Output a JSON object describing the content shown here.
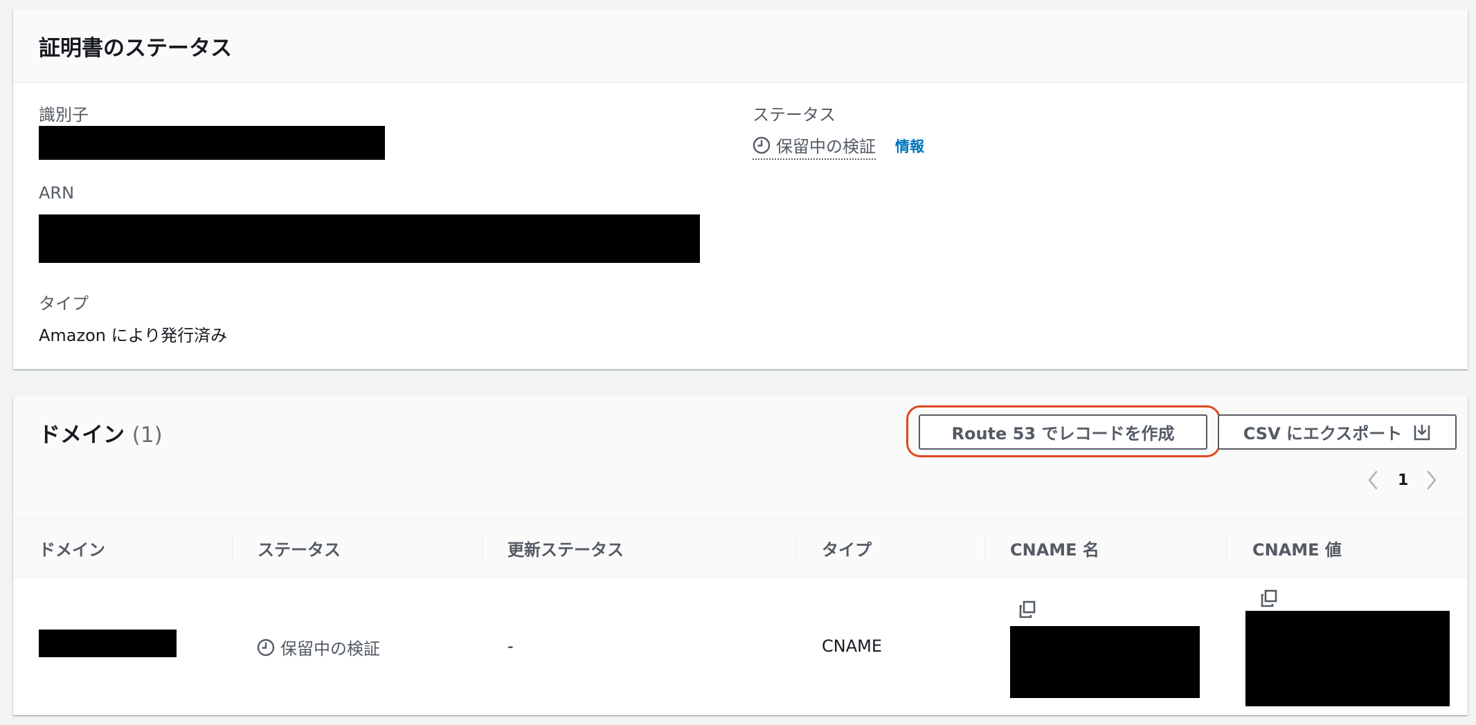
{
  "certificate_status": {
    "title": "証明書のステータス",
    "identifier_label": "識別子",
    "arn_label": "ARN",
    "type_label": "タイプ",
    "type_value": "Amazon により発行済み",
    "status_label": "ステータス",
    "status_value": "保留中の検証",
    "info_link": "情報"
  },
  "domains": {
    "title": "ドメイン",
    "count": "(1)",
    "create_route53_button": "Route 53 でレコードを作成",
    "export_csv_button": "CSV にエクスポート",
    "pagination": {
      "current_page": "1"
    },
    "columns": [
      "ドメイン",
      "ステータス",
      "更新ステータス",
      "タイプ",
      "CNAME 名",
      "CNAME 値"
    ],
    "rows": [
      {
        "status": "保留中の検証",
        "renewal_status": "-",
        "type": "CNAME"
      }
    ]
  },
  "icons": [
    "clock-icon",
    "download-icon",
    "chevron-left-icon",
    "chevron-right-icon",
    "copy-icon"
  ],
  "colors": {
    "info_link": "#0073bb",
    "highlight_outline": "#e2461e",
    "pending_text": "#545b64"
  }
}
